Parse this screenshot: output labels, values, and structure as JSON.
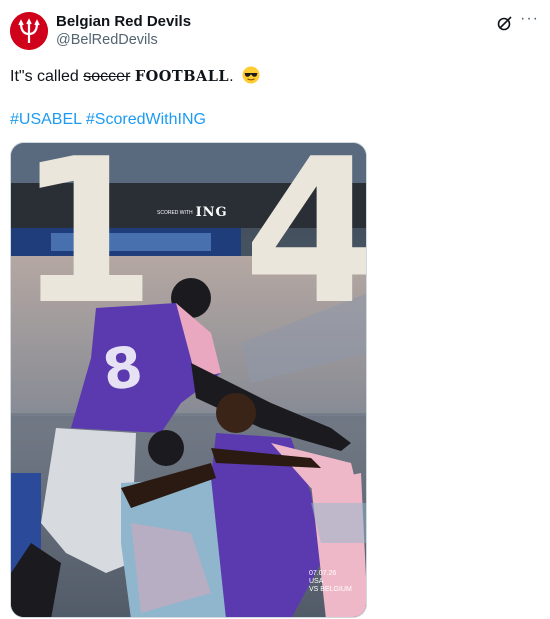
{
  "author": {
    "display_name": "Belgian Red Devils",
    "handle": "@BelRedDevils",
    "avatar_icon": "red-devils-trident-icon",
    "avatar_color": "#d0021b"
  },
  "header_icons": {
    "grok": "grok-icon",
    "more": "more-horizontal-icon",
    "more_glyph": "···"
  },
  "tweet": {
    "text_prefix": "It\"s called ",
    "struck_word": "soccer",
    "bold_word": "FOOTBALL",
    "suffix": ".",
    "emoji": "smiling-face-with-sunglasses"
  },
  "hashtags": [
    "#USABEL",
    "#ScoredWithING"
  ],
  "media": {
    "digit_left": "1",
    "digit_right": "4",
    "sponsor_small": "SCORED WITH",
    "sponsor": "ING",
    "match_date": "07.07.26",
    "match_home": "USA",
    "match_away": "VS BELGIUM",
    "jersey_number": "8",
    "accent_color": "#6a3fb4"
  },
  "colors": {
    "link": "#1d9bf0",
    "secondary_text": "#536471"
  }
}
